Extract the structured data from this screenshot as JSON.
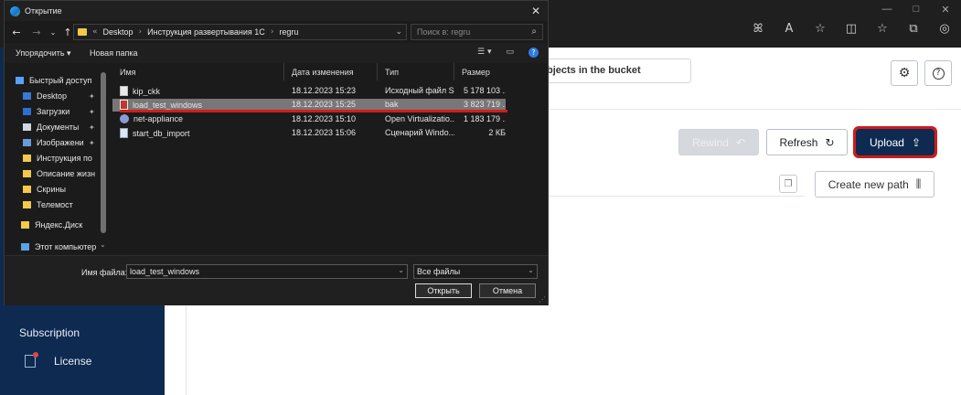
{
  "browser": {
    "window_controls": [
      "—",
      "□",
      "✕"
    ],
    "toolbar_icons": [
      "read-aloud-icon",
      "text-size-icon",
      "favorite-icon",
      "split-icon",
      "favorites-bar-icon",
      "collections-icon",
      "profile-icon"
    ],
    "toolbar_glyphs": [
      "ꕤ",
      "A",
      "☆",
      "◫",
      "☆",
      "⧉",
      "◎"
    ]
  },
  "app": {
    "search_placeholder": "bjects in the bucket",
    "sidebar": {
      "subscription": "Subscription",
      "license": "License"
    },
    "buttons": {
      "rewind": "Rewind",
      "refresh": "Refresh",
      "upload": "Upload",
      "create_new_path": "Create new path"
    },
    "colors": {
      "navy": "#0e2a50",
      "highlight_red": "#d21a1a"
    }
  },
  "dialog": {
    "title": "Открытие",
    "close_glyph": "✕",
    "address": {
      "parts": [
        "Desktop",
        "Инструкция развертывания 1С",
        "regru"
      ],
      "prefix": "«"
    },
    "search_placeholder": "Поиск в: regru",
    "commands": {
      "organize": "Упорядочить ▾",
      "new_folder": "Новая папка"
    },
    "columns": {
      "name": "Имя",
      "modified": "Дата изменения",
      "type": "Тип",
      "size": "Размер"
    },
    "nav_items": [
      {
        "label": "Быстрый доступ",
        "pinned": false
      },
      {
        "label": "Desktop",
        "pinned": true
      },
      {
        "label": "Загрузки",
        "pinned": true
      },
      {
        "label": "Документы",
        "pinned": true
      },
      {
        "label": "Изображени",
        "pinned": true
      },
      {
        "label": "Инструкция по",
        "pinned": false
      },
      {
        "label": "Описание жизн",
        "pinned": false
      },
      {
        "label": "Скрины",
        "pinned": false
      },
      {
        "label": "Телемост",
        "pinned": false
      },
      {
        "label": "Яндекс.Диск",
        "pinned": false
      },
      {
        "label": "Этот компьютер",
        "pinned": false
      }
    ],
    "files": [
      {
        "name": "kip_ckk",
        "modified": "18.12.2023 15:23",
        "type": "Исходный файл S...",
        "size": "5 178 103 ...",
        "selected": false
      },
      {
        "name": "load_test_windows",
        "modified": "18.12.2023 15:25",
        "type": "bak",
        "size": "3 823 719 ...",
        "selected": true
      },
      {
        "name": "net-appliance",
        "modified": "18.12.2023 15:10",
        "type": "Open Virtualizatio...",
        "size": "1 183 179 ...",
        "selected": false
      },
      {
        "name": "start_db_import",
        "modified": "18.12.2023 15:06",
        "type": "Сценарий Windo...",
        "size": "2 КБ",
        "selected": false
      }
    ],
    "filename_label": "Имя файла:",
    "filename_value": "load_test_windows",
    "filetype_value": "Все файлы",
    "open_label": "Открыть",
    "cancel_label": "Отмена"
  }
}
